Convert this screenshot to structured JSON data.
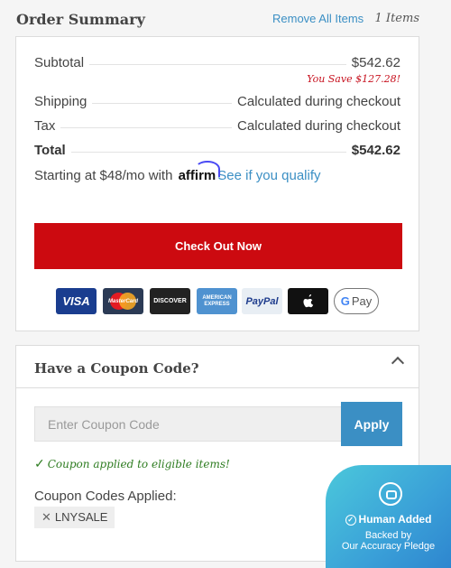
{
  "header": {
    "title": "Order Summary",
    "remove_all": "Remove All Items",
    "item_count": "1 Items"
  },
  "summary": {
    "subtotal_label": "Subtotal",
    "subtotal_value": "$542.62",
    "you_save": "You Save $127.28!",
    "shipping_label": "Shipping",
    "shipping_value": "Calculated during checkout",
    "tax_label": "Tax",
    "tax_value": "Calculated during checkout",
    "total_label": "Total",
    "total_value": "$542.62"
  },
  "affirm": {
    "prefix": "Starting at $48/mo with",
    "logo": "affirm",
    "link": "See if you qualify"
  },
  "checkout_button": "Check Out Now",
  "payment_methods": {
    "visa": "VISA",
    "mastercard": "MasterCard",
    "discover": "DISCOVER",
    "amex_line1": "AMERICAN",
    "amex_line2": "EXPRESS",
    "paypal": "PayPal",
    "gpay": "Pay",
    "gpay_g": "G"
  },
  "coupon": {
    "title": "Have a Coupon Code?",
    "placeholder": "Enter Coupon Code",
    "apply": "Apply",
    "applied_message": "Coupon applied to eligible items!",
    "codes_label": "Coupon Codes Applied:",
    "applied_code": "LNYSALE"
  },
  "badge": {
    "title": "Human Added",
    "line1": "Backed by",
    "line2": "Our Accuracy Pledge"
  },
  "colors": {
    "checkout": "#cc0a10",
    "link": "#3b8fc4",
    "savings": "#c7111e",
    "success": "#2f7d22"
  }
}
